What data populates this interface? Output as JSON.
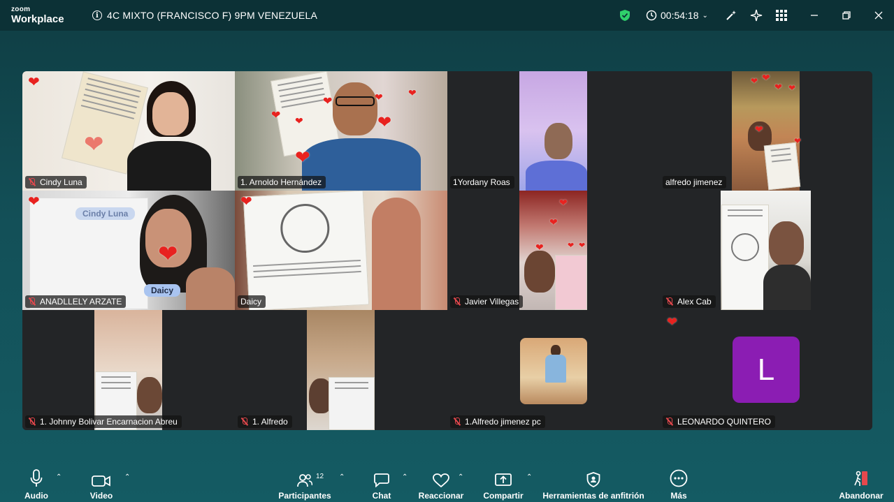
{
  "app": {
    "logo_top": "zoom",
    "logo_bottom": "Workplace"
  },
  "meeting": {
    "title": "4C MIXTO (FRANCISCO F) 9PM VENEZUELA",
    "timer": "00:54:18"
  },
  "participants": [
    {
      "name": "Cindy Luna",
      "muted": true
    },
    {
      "name": "1. Arnoldo Hernández",
      "muted": false
    },
    {
      "name": "1Yordany Roas",
      "muted": false
    },
    {
      "name": "alfredo jimenez",
      "muted": false
    },
    {
      "name": "ANADLLELY ARZATE",
      "muted": true
    },
    {
      "name": "Daicy",
      "muted": false
    },
    {
      "name": "Javier Villegas",
      "muted": true
    },
    {
      "name": "Alex Cab",
      "muted": true
    },
    {
      "name": "1. Johnny Bolivar Encarnacion Abreu",
      "muted": true
    },
    {
      "name": "1. Alfredo",
      "muted": true
    },
    {
      "name": "1.Alfredo jimenez pc",
      "muted": true
    },
    {
      "name": "LEONARDO QUINTERO",
      "muted": true
    }
  ],
  "overlays": {
    "filter_name_1": "Cindy Luna",
    "filter_name_2": "Daicy",
    "avatar_initial": "L"
  },
  "toolbar": {
    "audio": "Audio",
    "video": "Video",
    "participants": "Participantes",
    "participants_count": "12",
    "chat": "Chat",
    "react": "Reaccionar",
    "share": "Compartir",
    "host_tools": "Herramientas de anfitrión",
    "more": "Más",
    "leave": "Abandonar"
  },
  "colors": {
    "accent_green": "#3ed07b",
    "muted_red": "#e5484d",
    "heart_red": "#e8221f",
    "avatar_purple": "#8b1db3"
  }
}
